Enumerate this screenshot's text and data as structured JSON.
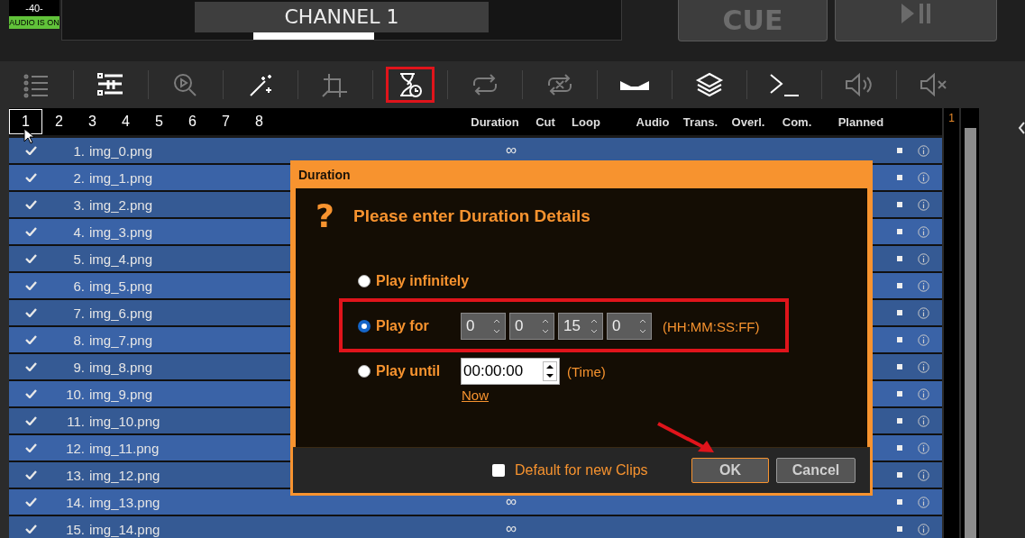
{
  "audio_meter": {
    "reading": "-40-",
    "status": "AUDIO IS ON",
    "on": true
  },
  "channel": {
    "name": "CHANNEL 1"
  },
  "cue_button": {
    "label": "CUE"
  },
  "toolbar": [
    {
      "kind": "list",
      "disabled": true,
      "selected": false
    },
    {
      "kind": "pause-list",
      "disabled": false,
      "selected": false
    },
    {
      "kind": "zoom-play",
      "disabled": true,
      "selected": false
    },
    {
      "kind": "wand",
      "disabled": false,
      "selected": false
    },
    {
      "kind": "crop",
      "disabled": true,
      "selected": false
    },
    {
      "kind": "hourglass",
      "disabled": false,
      "selected": true
    },
    {
      "kind": "repeat",
      "disabled": true,
      "selected": false
    },
    {
      "kind": "repeat-off",
      "disabled": true,
      "selected": false
    },
    {
      "kind": "audio-bar",
      "disabled": false,
      "selected": false
    },
    {
      "kind": "layers",
      "disabled": false,
      "selected": false
    },
    {
      "kind": "terminal",
      "disabled": false,
      "selected": false
    },
    {
      "kind": "speaker",
      "disabled": true,
      "selected": false
    },
    {
      "kind": "mute",
      "disabled": true,
      "selected": false
    }
  ],
  "tabs": [
    {
      "label": "1",
      "selected": true
    },
    {
      "label": "2",
      "selected": false
    },
    {
      "label": "3",
      "selected": false
    },
    {
      "label": "4",
      "selected": false
    },
    {
      "label": "5",
      "selected": false
    },
    {
      "label": "6",
      "selected": false
    },
    {
      "label": "7",
      "selected": false
    },
    {
      "label": "8",
      "selected": false
    }
  ],
  "columns": [
    "Duration",
    "Cut",
    "Loop",
    "Audio",
    "Trans.",
    "Overl.",
    "Com.",
    "Planned"
  ],
  "rows": [
    {
      "number": "1.",
      "name": "img_0.png",
      "checked": true,
      "duration": "∞"
    },
    {
      "number": "2.",
      "name": "img_1.png",
      "checked": true
    },
    {
      "number": "3.",
      "name": "img_2.png",
      "checked": true
    },
    {
      "number": "4.",
      "name": "img_3.png",
      "checked": true
    },
    {
      "number": "5.",
      "name": "img_4.png",
      "checked": true
    },
    {
      "number": "6.",
      "name": "img_5.png",
      "checked": true
    },
    {
      "number": "7.",
      "name": "img_6.png",
      "checked": true
    },
    {
      "number": "8.",
      "name": "img_7.png",
      "checked": true
    },
    {
      "number": "9.",
      "name": "img_8.png",
      "checked": true
    },
    {
      "number": "10.",
      "name": "img_9.png",
      "checked": true
    },
    {
      "number": "11.",
      "name": "img_10.png",
      "checked": true
    },
    {
      "number": "12.",
      "name": "img_11.png",
      "checked": true
    },
    {
      "number": "13.",
      "name": "img_12.png",
      "checked": true
    },
    {
      "number": "14.",
      "name": "img_13.png",
      "checked": true,
      "duration": "∞"
    },
    {
      "number": "15.",
      "name": "img_14.png",
      "checked": true,
      "duration": "∞"
    }
  ],
  "side_counter": "1",
  "dialog": {
    "title": "Duration",
    "question_mark": "?",
    "heading": "Please enter Duration Details",
    "options": [
      {
        "kind": "infinite",
        "label": "Play infinitely",
        "selected": false
      },
      {
        "kind": "duration",
        "label": "Play for",
        "selected": true,
        "fields": [
          "0",
          "0",
          "15",
          "0"
        ],
        "hint": "(HH:MM:SS:FF)"
      },
      {
        "kind": "until",
        "label": "Play until",
        "selected": false,
        "value": "00:00:00",
        "hint": "(Time)",
        "link": "Now"
      }
    ],
    "default_checkbox": {
      "label": "Default for new Clips",
      "checked": false
    },
    "buttons": [
      {
        "label": "OK",
        "kind": "primary"
      },
      {
        "label": "Cancel",
        "kind": "secondary"
      }
    ]
  }
}
